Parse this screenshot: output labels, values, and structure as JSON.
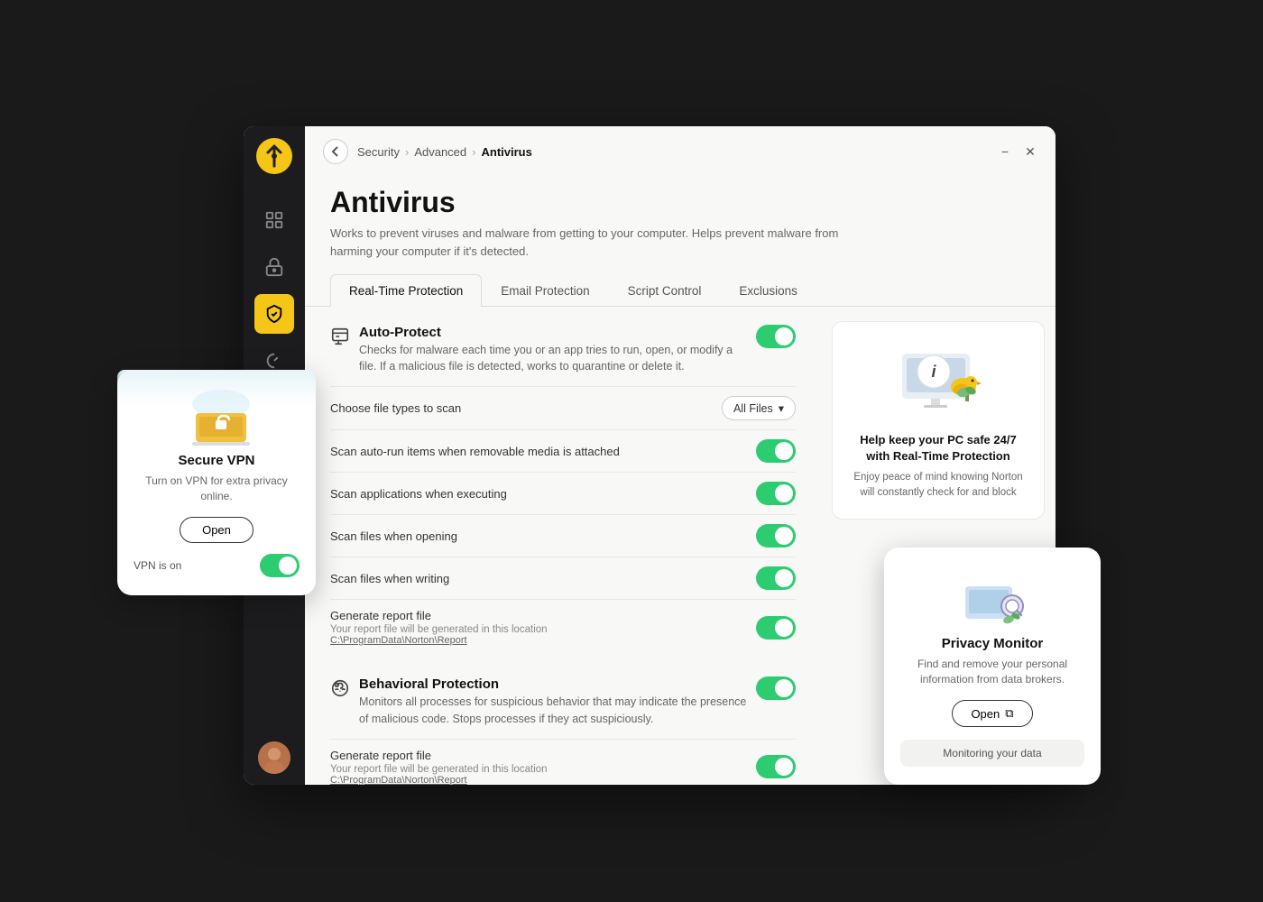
{
  "app": {
    "title": "Norton",
    "logo_alt": "Norton logo"
  },
  "sidebar": {
    "icons": [
      {
        "name": "dashboard-icon",
        "symbol": "⊙",
        "active": false
      },
      {
        "name": "vault-icon",
        "symbol": "🔒",
        "active": false
      },
      {
        "name": "shield-icon",
        "symbol": "🛡",
        "active": true
      },
      {
        "name": "speedometer-icon",
        "symbol": "⟳",
        "active": false
      },
      {
        "name": "apps-icon",
        "symbol": "⊞",
        "active": false
      }
    ]
  },
  "window": {
    "minimize_label": "−",
    "close_label": "✕"
  },
  "breadcrumb": {
    "security": "Security",
    "advanced": "Advanced",
    "current": "Antivirus"
  },
  "page": {
    "title": "Antivirus",
    "description": "Works to prevent viruses and malware from getting to your computer. Helps prevent malware from harming your computer if it's detected."
  },
  "tabs": [
    {
      "id": "real-time",
      "label": "Real-Time Protection",
      "active": true
    },
    {
      "id": "email",
      "label": "Email Protection",
      "active": false
    },
    {
      "id": "script",
      "label": "Script Control",
      "active": false
    },
    {
      "id": "exclusions",
      "label": "Exclusions",
      "active": false
    }
  ],
  "auto_protect": {
    "title": "Auto-Protect",
    "description": "Checks for malware each time you or an app tries to run, open, or modify a file. If a malicious file is detected, works to quarantine or delete it.",
    "enabled": true,
    "file_types_label": "Choose file types to scan",
    "file_types_value": "All Files",
    "settings": [
      {
        "label": "Scan auto-run items when removable media is attached",
        "enabled": true,
        "sub": null
      },
      {
        "label": "Scan applications when executing",
        "enabled": true,
        "sub": null
      },
      {
        "label": "Scan files when opening",
        "enabled": true,
        "sub": null
      },
      {
        "label": "Scan files when writing",
        "enabled": true,
        "sub": null
      },
      {
        "label": "Generate report file",
        "enabled": true,
        "sub": "Your report file will be generated in this location",
        "link": "C:\\ProgramData\\Norton\\Report"
      }
    ]
  },
  "behavioral_protection": {
    "title": "Behavioral Protection",
    "description": "Monitors all processes for suspicious behavior that may indicate the presence of malicious code. Stops processes if they act suspiciously.",
    "enabled": true,
    "settings": [
      {
        "label": "Generate report file",
        "enabled": true,
        "sub": "Your report file will be generated in this location",
        "link": "C:\\ProgramData\\Norton\\Report"
      }
    ]
  },
  "info_card": {
    "title": "Help keep your PC safe 24/7 with Real-Time Protection",
    "description": "Enjoy peace of mind knowing Norton will constantly check for and block"
  },
  "vpn_popup": {
    "title": "Secure VPN",
    "description": "Turn on VPN for extra privacy online.",
    "button_label": "Open",
    "status_label": "VPN is on",
    "enabled": true
  },
  "privacy_popup": {
    "illustration_alt": "Privacy Monitor illustration",
    "title": "Privacy Monitor",
    "description": "Find and remove your personal information from data brokers.",
    "button_label": "Open",
    "status_label": "Monitoring your data"
  }
}
